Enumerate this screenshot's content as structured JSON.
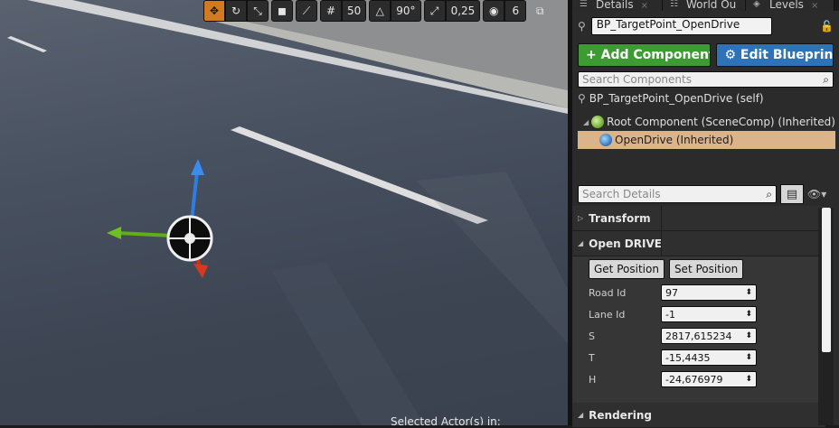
{
  "viewport": {
    "toolbar": {
      "snap_grid_value": "50",
      "rotation_snap_value": "90°",
      "scale_snap_value": "0,25",
      "camera_speed_value": "6"
    },
    "status_text": "Selected Actor(s) in:"
  },
  "tabs": [
    {
      "label": "Details"
    },
    {
      "label": "World Ou"
    },
    {
      "label": "Levels"
    }
  ],
  "details": {
    "actor_name": "BP_TargetPoint_OpenDrive",
    "add_component_label": "+ Add Component ▾",
    "edit_blueprint_label": "⚙ Edit Blueprint ▾",
    "search_components_placeholder": "Search Components",
    "components": [
      {
        "label": "BP_TargetPoint_OpenDrive (self)"
      },
      {
        "label": "Root Component (SceneComp) (Inherited)"
      },
      {
        "label": "OpenDrive (Inherited)"
      }
    ],
    "search_details_placeholder": "Search Details",
    "sections": {
      "transform": "Transform",
      "opendrive": "Open DRIVE",
      "rendering": "Rendering"
    },
    "get_position_label": "Get Position",
    "set_position_label": "Set Position",
    "properties": [
      {
        "label": "Road Id",
        "value": "97"
      },
      {
        "label": "Lane Id",
        "value": "-1"
      },
      {
        "label": "S",
        "value": "2817,615234"
      },
      {
        "label": "T",
        "value": "-15,4435"
      },
      {
        "label": "H",
        "value": "-24,676979"
      }
    ]
  },
  "colors": {
    "accent_orange": "#d27b1e",
    "add_component_green": "#3e9b33",
    "edit_blueprint_blue": "#2e73b8",
    "selection_tan": "#dcb48a"
  }
}
